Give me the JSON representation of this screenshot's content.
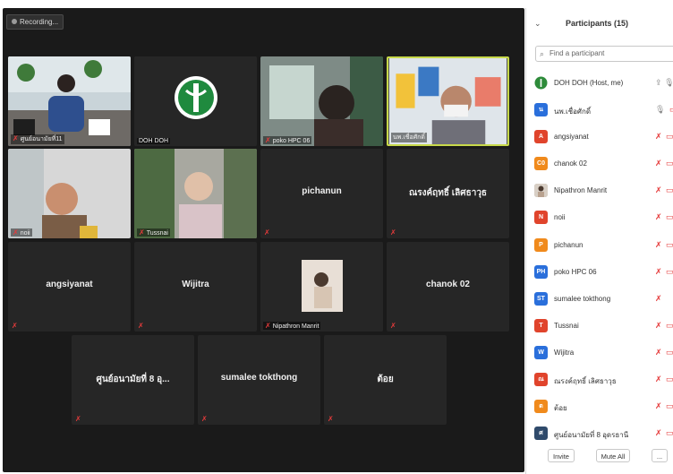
{
  "recording": {
    "label": "Recording..."
  },
  "tiles": [
    {
      "name": "",
      "label": "ศูนย์อนามัยที่11"
    },
    {
      "name": "",
      "label": "DOH DOH"
    },
    {
      "name": "",
      "label": "poko HPC 06"
    },
    {
      "name": "",
      "label": "นพ.เชื่อศักดิ์"
    },
    {
      "name": "",
      "label": "noii"
    },
    {
      "name": "",
      "label": "Tussnai"
    },
    {
      "name": "pichanun",
      "label": ""
    },
    {
      "name": "ณรงค์ฤทธิ์ เลิศธาวุธ",
      "label": ""
    },
    {
      "name": "angsiyanat",
      "label": ""
    },
    {
      "name": "Wijitra",
      "label": ""
    },
    {
      "name": "",
      "label": "Nipathron Manrit"
    },
    {
      "name": "chanok 02",
      "label": ""
    },
    {
      "name": "ศูนย์อนามัยที่ 8 อุ...",
      "label": ""
    },
    {
      "name": "sumalee tokthong",
      "label": ""
    },
    {
      "name": "ต้อย",
      "label": ""
    }
  ],
  "panel": {
    "title": "Participants (15)",
    "search_placeholder": "Find a participant",
    "participants": [
      {
        "initials": "",
        "name": "DOH DOH (Host, me)",
        "color": "#2e8b3a"
      },
      {
        "initials": "น",
        "name": "นพ.เชื่อศักดิ์",
        "color": "#2a6fdb"
      },
      {
        "initials": "A",
        "name": "angsiyanat",
        "color": "#e0442c"
      },
      {
        "initials": "C0",
        "name": "chanok 02",
        "color": "#f08a1c"
      },
      {
        "initials": "",
        "name": "Nipathron Manrit",
        "color": "#b7a89a"
      },
      {
        "initials": "N",
        "name": "noii",
        "color": "#e0442c"
      },
      {
        "initials": "P",
        "name": "pichanun",
        "color": "#f08a1c"
      },
      {
        "initials": "PH",
        "name": "poko HPC 06",
        "color": "#2a6fdb"
      },
      {
        "initials": "ST",
        "name": "sumalee tokthong",
        "color": "#2a6fdb"
      },
      {
        "initials": "T",
        "name": "Tussnai",
        "color": "#e0442c"
      },
      {
        "initials": "W",
        "name": "Wijitra",
        "color": "#2a6fdb"
      },
      {
        "initials": "ณ",
        "name": "ณรงค์ฤทธิ์ เลิศธาวุธ",
        "color": "#e0442c"
      },
      {
        "initials": "ต",
        "name": "ต้อย",
        "color": "#f08a1c"
      },
      {
        "initials": "ศ",
        "name": "ศูนย์อนามัยที่ 8 อุดรธานี",
        "color": "#2f4a6b"
      }
    ],
    "buttons": {
      "invite": "Invite",
      "mute_all": "Mute All",
      "more": "..."
    }
  }
}
